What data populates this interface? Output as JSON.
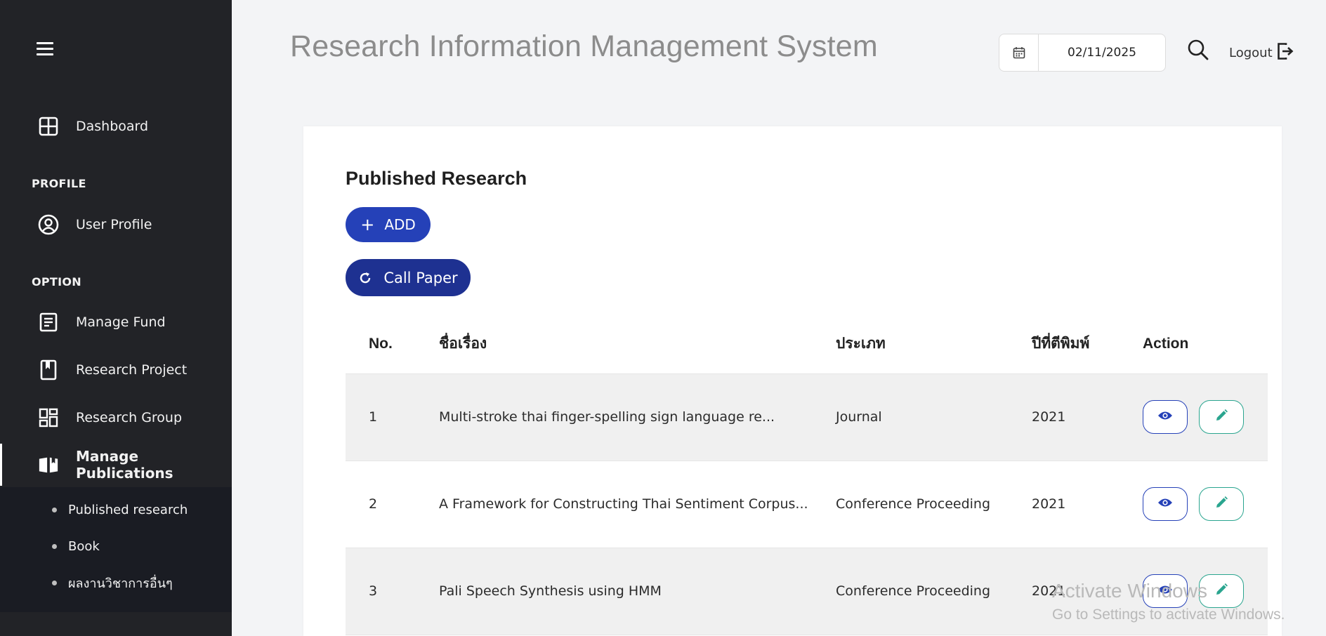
{
  "app": {
    "title": "Research Information Management System"
  },
  "header": {
    "date": "02/11/2025",
    "logout_label": "Logout"
  },
  "sidebar": {
    "dashboard": "Dashboard",
    "profile_section": "PROFILE",
    "user_profile": "User Profile",
    "option_section": "OPTION",
    "manage_fund": "Manage Fund",
    "research_project": "Research Project",
    "research_group": "Research Group",
    "manage_publications": "Manage Publications",
    "submenu": [
      "Published research",
      "Book",
      "ผลงานวิชาการอื่นๆ"
    ]
  },
  "main": {
    "card_title": "Published Research",
    "add_label": "ADD",
    "call_paper_label": "Call Paper",
    "columns": [
      "No.",
      "ชื่อเรื่อง",
      "ประเภท",
      "ปีที่ตีพิมพ์",
      "Action"
    ],
    "rows": [
      {
        "no": "1",
        "title": "Multi-stroke thai finger-spelling sign language re...",
        "type": "Journal",
        "year": "2021"
      },
      {
        "no": "2",
        "title": "A Framework for Constructing Thai Sentiment Corpus...",
        "type": "Conference Proceeding",
        "year": "2021"
      },
      {
        "no": "3",
        "title": "Pali Speech Synthesis using HMM",
        "type": "Conference Proceeding",
        "year": "2021"
      }
    ]
  },
  "watermark": {
    "line1": "Activate Windows",
    "line2": "Go to Settings to activate Windows."
  },
  "colors": {
    "sidebar": "#222327",
    "primary": "#2541b8",
    "edit": "#2aa58f"
  }
}
